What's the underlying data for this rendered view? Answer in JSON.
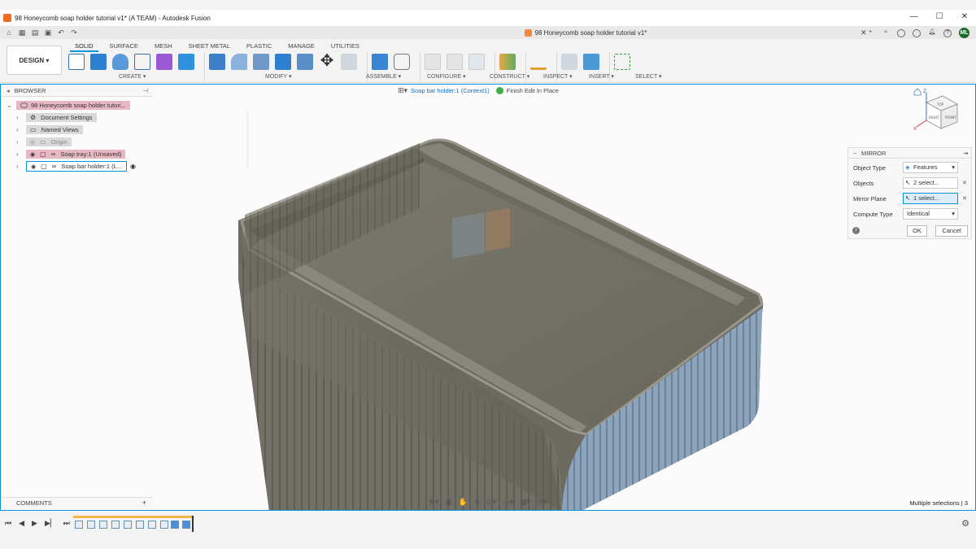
{
  "window": {
    "title": "98 Honeycomb soap holder tutorial v1* (A TEAM) - Autodesk Fusion",
    "min": "—",
    "max": "☐",
    "close": "✕"
  },
  "doc_tab": {
    "title": "98 Honeycomb soap holder tutorial v1*",
    "close": "✕"
  },
  "user": {
    "initials": "ML"
  },
  "ribbon": {
    "workspace": "DESIGN ▾",
    "tabs": [
      "SOLID",
      "SURFACE",
      "MESH",
      "SHEET METAL",
      "PLASTIC",
      "MANAGE",
      "UTILITIES"
    ],
    "groups": [
      "CREATE ▾",
      "MODIFY ▾",
      "ASSEMBLE ▾",
      "CONFIGURE ▾",
      "CONSTRUCT ▾",
      "INSPECT ▾",
      "INSERT ▾",
      "SELECT ▾"
    ]
  },
  "browser": {
    "header": "BROWSER",
    "items": [
      {
        "label": "98 Honeycomb soap holder tutori...",
        "style": "pink"
      },
      {
        "label": "Document Settings",
        "style": "grey"
      },
      {
        "label": "Named Views",
        "style": "grey"
      },
      {
        "label": "Origin",
        "style": "grey"
      },
      {
        "label": "Soap tray:1 (Unsaved)",
        "style": "pink"
      },
      {
        "label": "Soap bar holder:1 (L...",
        "style": "selected"
      }
    ]
  },
  "comments": {
    "label": "COMMENTS",
    "plus": "+"
  },
  "context": {
    "component": "Soap bar holder:1 (Context1)",
    "finish": "Finish Edit In Place"
  },
  "viewcube": {
    "top": "TOP",
    "front": "FRONT",
    "right": "RIGHT",
    "z": "Z",
    "x": "X"
  },
  "mirror": {
    "header": "MIRROR",
    "rows": [
      {
        "label": "Object Type",
        "value": "Features",
        "kind": "dropdown"
      },
      {
        "label": "Objects",
        "value": "2 select...",
        "kind": "select"
      },
      {
        "label": "Mirror Plane",
        "value": "1 select...",
        "kind": "select-active"
      },
      {
        "label": "Compute Type",
        "value": "Identical",
        "kind": "dropdown"
      }
    ],
    "ok": "OK",
    "cancel": "Cancel"
  },
  "status": "Multiple selections | 3",
  "colors": {
    "accent": "#0696d7",
    "model": "#6f6d62",
    "highlight": "#8fb4d9"
  }
}
